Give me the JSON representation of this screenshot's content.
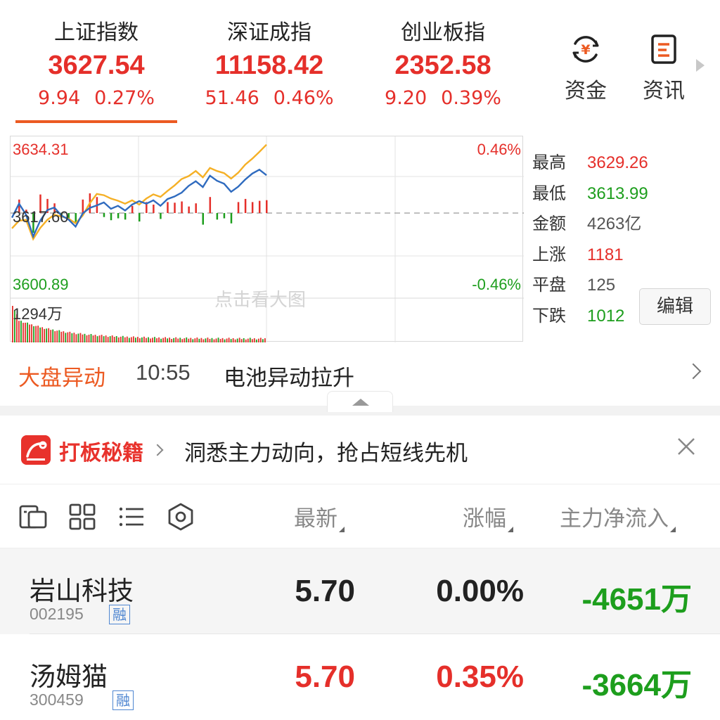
{
  "indices": [
    {
      "name": "上证指数",
      "price": "3627.54",
      "change": "9.94",
      "percent": "0.27%"
    },
    {
      "name": "深证成指",
      "price": "11158.42",
      "change": "51.46",
      "percent": "0.46%"
    },
    {
      "name": "创业板指",
      "price": "2352.58",
      "change": "9.20",
      "percent": "0.39%"
    }
  ],
  "tools": {
    "fund_label": "资金",
    "news_label": "资讯"
  },
  "chart": {
    "price_high_label": "3634.31",
    "price_mid_label": "3617.60",
    "price_low_label": "3600.89",
    "pct_high_label": "0.46%",
    "pct_low_label": "-0.46%",
    "volume_label": "1294万",
    "watermark": "点击看大图",
    "colors": {
      "index_line": "#2f6bbf",
      "avg_line": "#f5b026",
      "up": "#e52f2a",
      "down": "#1d9e1d"
    }
  },
  "chart_data": {
    "type": "line",
    "ylim": [
      3600.89,
      3634.31
    ],
    "prev_close": 3617.6,
    "series": [
      {
        "values": [
          3616.5,
          3619.8,
          3617.2,
          3612.1,
          3615.8,
          3618.3,
          3618.9,
          3617.0,
          3616.1,
          3614.4,
          3617.5,
          3618.8,
          3619.4,
          3620.1,
          3618.6,
          3619.3,
          3618.2,
          3619.6,
          3620.4,
          3619.8,
          3620.6,
          3619.3,
          3620.9,
          3621.5,
          3622.4,
          3624.0,
          3625.1,
          3623.7,
          3626.4,
          3625.2,
          3624.5,
          3622.6,
          3623.8,
          3625.5,
          3626.9,
          3627.8,
          3626.5
        ]
      },
      {
        "values": [
          3614.0,
          3615.8,
          3616.0,
          3611.5,
          3614.1,
          3616.0,
          3617.2,
          3616.8,
          3616.3,
          3615.2,
          3617.0,
          3619.9,
          3622.1,
          3621.8,
          3621.0,
          3620.5,
          3619.8,
          3620.6,
          3619.6,
          3621.0,
          3622.0,
          3621.4,
          3622.8,
          3624.1,
          3625.6,
          3626.3,
          3627.5,
          3626.0,
          3628.2,
          3627.5,
          3627.0,
          3625.7,
          3627.1,
          3629.0,
          3630.4,
          3632.0,
          3633.7
        ]
      }
    ]
  },
  "stats": [
    {
      "key": "最高",
      "value": "3629.26",
      "tone": "red"
    },
    {
      "key": "最低",
      "value": "3613.99",
      "tone": "green"
    },
    {
      "key": "金额",
      "value": "4263亿",
      "tone": "gray"
    },
    {
      "key": "上涨",
      "value": "1181",
      "tone": "red"
    },
    {
      "key": "平盘",
      "value": "125",
      "tone": "gray"
    },
    {
      "key": "下跌",
      "value": "1012",
      "tone": "green"
    }
  ],
  "edit_label": "编辑",
  "market_move": {
    "title": "大盘异动",
    "time": "10:55",
    "text": "电池异动拉升"
  },
  "promo": {
    "brand": "打板秘籍",
    "slogan": "洞悉主力动向，抢占短线先机"
  },
  "list_header": {
    "latest": "最新",
    "change": "涨幅",
    "flow": "主力净流入"
  },
  "stocks": [
    {
      "name": "岩山科技",
      "code": "002195",
      "tag": "融",
      "price": "5.70",
      "percent": "0.00%",
      "flow": "-4651万",
      "price_tone": "dark",
      "percent_tone": "dark",
      "flow_tone": "green"
    },
    {
      "name": "汤姆猫",
      "code": "300459",
      "tag": "融",
      "price": "5.70",
      "percent": "0.35%",
      "flow": "-3664万",
      "price_tone": "red",
      "percent_tone": "red",
      "flow_tone": "green"
    }
  ]
}
